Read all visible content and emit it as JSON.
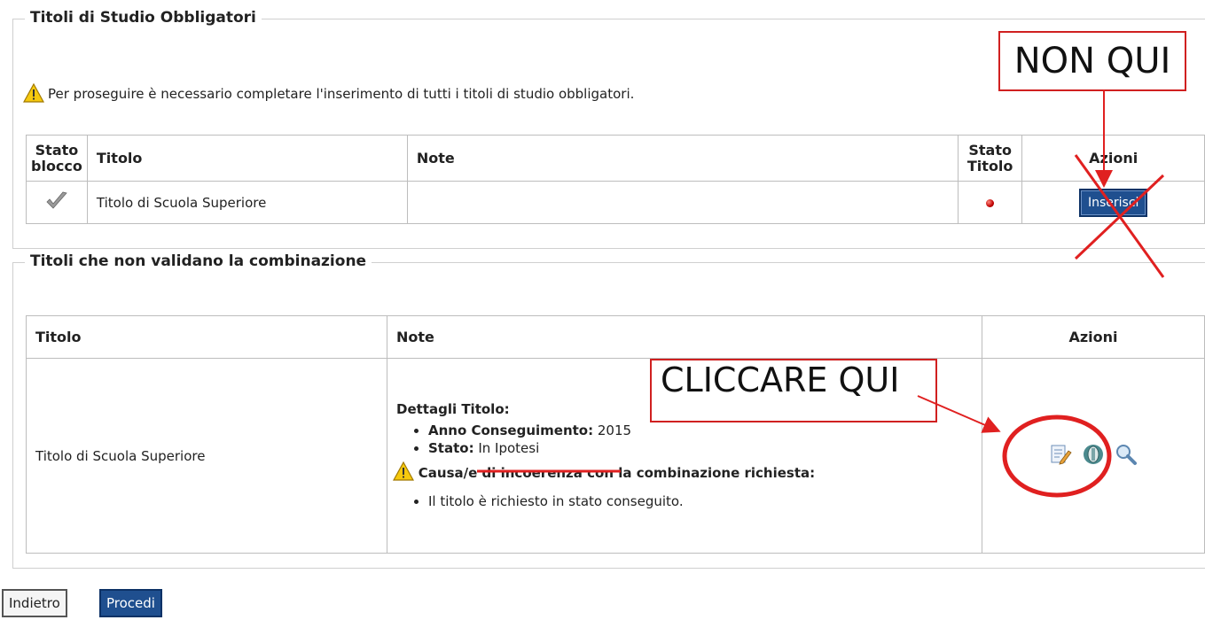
{
  "section1": {
    "title": "Titoli di Studio Obbligatori",
    "warning": "Per proseguire è necessario completare l'inserimento di tutti i titoli di studio obbligatori.",
    "table": {
      "headers": [
        "Stato blocco",
        "Titolo",
        "Note",
        "Stato Titolo",
        "Azioni"
      ],
      "rows": [
        {
          "titolo": "Titolo di Scuola Superiore",
          "note": "",
          "azione": "Inserisci"
        }
      ]
    }
  },
  "section2": {
    "title": "Titoli che non validano la combinazione",
    "table": {
      "headers": [
        "Titolo",
        "Note",
        "Azioni"
      ],
      "rows": [
        {
          "titolo": "Titolo di Scuola Superiore",
          "details_title": "Dettagli Titolo:",
          "anno_label": "Anno Conseguimento:",
          "anno_value": "2015",
          "stato_label": "Stato:",
          "stato_value": "In Ipotesi",
          "causa": "Causa/e di incoerenza con la combinazione richiesta:",
          "causa_item": "Il titolo è richiesto in stato conseguito."
        }
      ]
    }
  },
  "buttons": {
    "back": "Indietro",
    "next": "Procedi"
  },
  "annotations": {
    "not_here": "NON QUI",
    "click_here": "CLICCARE QUI"
  },
  "icons": [
    "check-icon",
    "warning-icon",
    "status-red-icon",
    "edit-icon",
    "delete-icon",
    "view-icon"
  ],
  "colors": {
    "annotation_red": "#e02020",
    "button_blue": "#1f4f8f"
  }
}
